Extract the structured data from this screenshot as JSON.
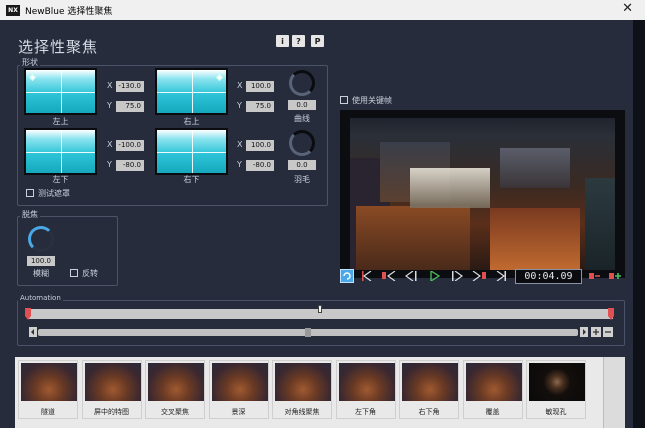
{
  "window": {
    "app_icon_text": "NX",
    "title": "NewBlue 选择性聚焦",
    "close_glyph": "✕"
  },
  "header": {
    "title": "选择性聚焦",
    "buttons": [
      "i",
      "?",
      "P"
    ]
  },
  "shape_group": {
    "label": "形状",
    "quads": [
      {
        "label": "左上",
        "x": "-130.0",
        "y": "75.0"
      },
      {
        "label": "右上",
        "x": "100.0",
        "y": "75.0"
      },
      {
        "label": "左下",
        "x": "-100.0",
        "y": "-80.0"
      },
      {
        "label": "右下",
        "x": "100.0",
        "y": "-80.0"
      }
    ],
    "x_label": "X",
    "y_label": "Y",
    "curve": {
      "label": "曲线",
      "value": "0.0"
    },
    "feather": {
      "label": "羽毛",
      "value": "0.0"
    },
    "test_mask": {
      "label": "测试遮罩",
      "checked": false
    }
  },
  "defocus_group": {
    "label": "脱焦",
    "blur": {
      "label": "模糊",
      "value": "100.0"
    },
    "invert": {
      "label": "反转",
      "checked": false
    }
  },
  "keyframes": {
    "label": "使用关键帧",
    "checked": false
  },
  "transport": {
    "timecode": "00:04.09",
    "icons": [
      "loop-icon",
      "go-start-icon",
      "prev-keyframe-icon",
      "step-back-icon",
      "play-icon",
      "step-forward-icon",
      "next-keyframe-icon",
      "go-end-icon",
      "delete-keyframe-icon",
      "add-keyframe-icon"
    ]
  },
  "automation": {
    "label": "Automation"
  },
  "presets": [
    {
      "label": "隧道",
      "dark": false
    },
    {
      "label": "屏中的特图",
      "dark": false
    },
    {
      "label": "交叉聚焦",
      "dark": false
    },
    {
      "label": "景深",
      "dark": false
    },
    {
      "label": "对角线聚焦",
      "dark": false
    },
    {
      "label": "左下角",
      "dark": false
    },
    {
      "label": "右下角",
      "dark": false
    },
    {
      "label": "覆盖",
      "dark": false
    },
    {
      "label": "敏现孔",
      "dark": true
    }
  ],
  "colors": {
    "accent": "#4aa8e8",
    "keyframe_red": "#e05050",
    "play_green": "#4cc060"
  }
}
